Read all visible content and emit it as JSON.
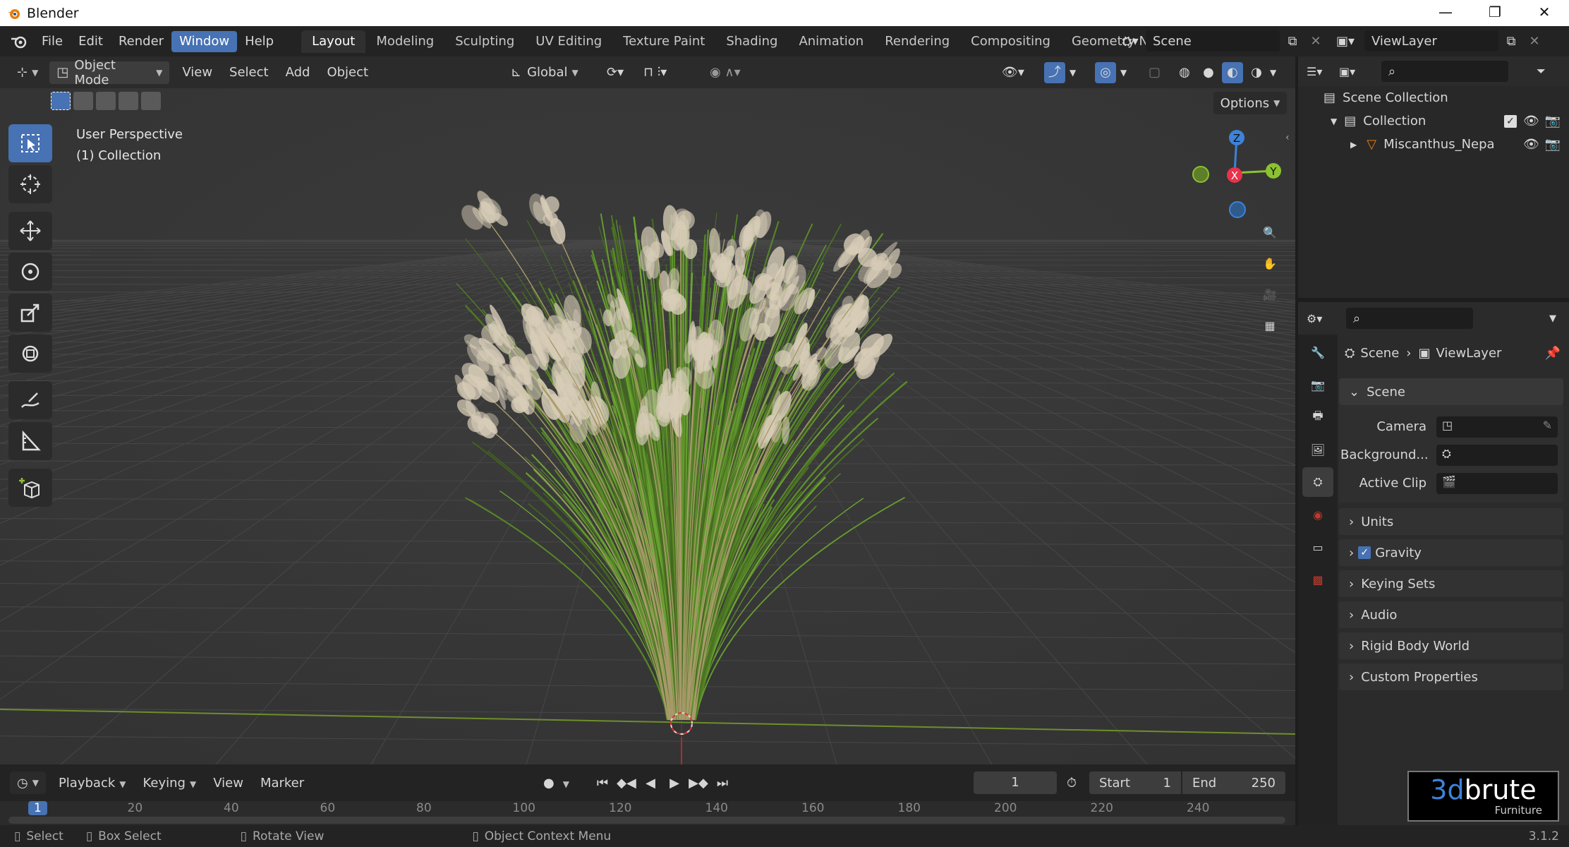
{
  "titlebar": {
    "title": "Blender",
    "minimize": "—",
    "maximize": "❐",
    "close": "✕"
  },
  "menus": [
    "File",
    "Edit",
    "Render",
    "Window",
    "Help"
  ],
  "workspaces": [
    "Layout",
    "Modeling",
    "Sculpting",
    "UV Editing",
    "Texture Paint",
    "Shading",
    "Animation",
    "Rendering",
    "Compositing",
    "Geometry Nod"
  ],
  "scene_field": "Scene",
  "viewlayer_field": "ViewLayer",
  "header3d": {
    "mode": "Object Mode",
    "menus": [
      "View",
      "Select",
      "Add",
      "Object"
    ],
    "transform": "Global"
  },
  "viewport": {
    "perspective": "User Perspective",
    "collection": "(1) Collection",
    "options": "Options"
  },
  "gizmo": {
    "z": "Z",
    "x": "X",
    "y": "Y"
  },
  "outliner": {
    "scene_collection": "Scene Collection",
    "collection": "Collection",
    "object": "Miscanthus_Nepa"
  },
  "properties": {
    "breadcrumb_scene": "Scene",
    "breadcrumb_sep": "›",
    "breadcrumb_viewlayer": "ViewLayer",
    "panel_scene": "Scene",
    "camera_label": "Camera",
    "background_label": "Background...",
    "active_clip_label": "Active Clip",
    "panels": [
      "Units",
      "Gravity",
      "Keying Sets",
      "Audio",
      "Rigid Body World",
      "Custom Properties"
    ]
  },
  "timeline": {
    "playback": "Playback",
    "keying": "Keying",
    "view": "View",
    "marker": "Marker",
    "current_frame": "1",
    "start_label": "Start",
    "start": "1",
    "end_label": "End",
    "end": "250"
  },
  "ruler_ticks": [
    "1",
    "20",
    "40",
    "60",
    "80",
    "100",
    "120",
    "140",
    "160",
    "180",
    "200",
    "220",
    "240"
  ],
  "status": {
    "select": "Select",
    "box_select": "Box Select",
    "rotate_view": "Rotate View",
    "context_menu": "Object Context Menu",
    "version": "3.1.2"
  },
  "watermark": {
    "brand_a": "3d",
    "brand_b": "brute",
    "sub": "Furniture"
  },
  "colors": {
    "accent": "#4772b3",
    "axis_x": "#e8334b",
    "axis_y": "#8bc22f",
    "axis_z": "#3d83d9",
    "viewport_bg": "#393939"
  }
}
